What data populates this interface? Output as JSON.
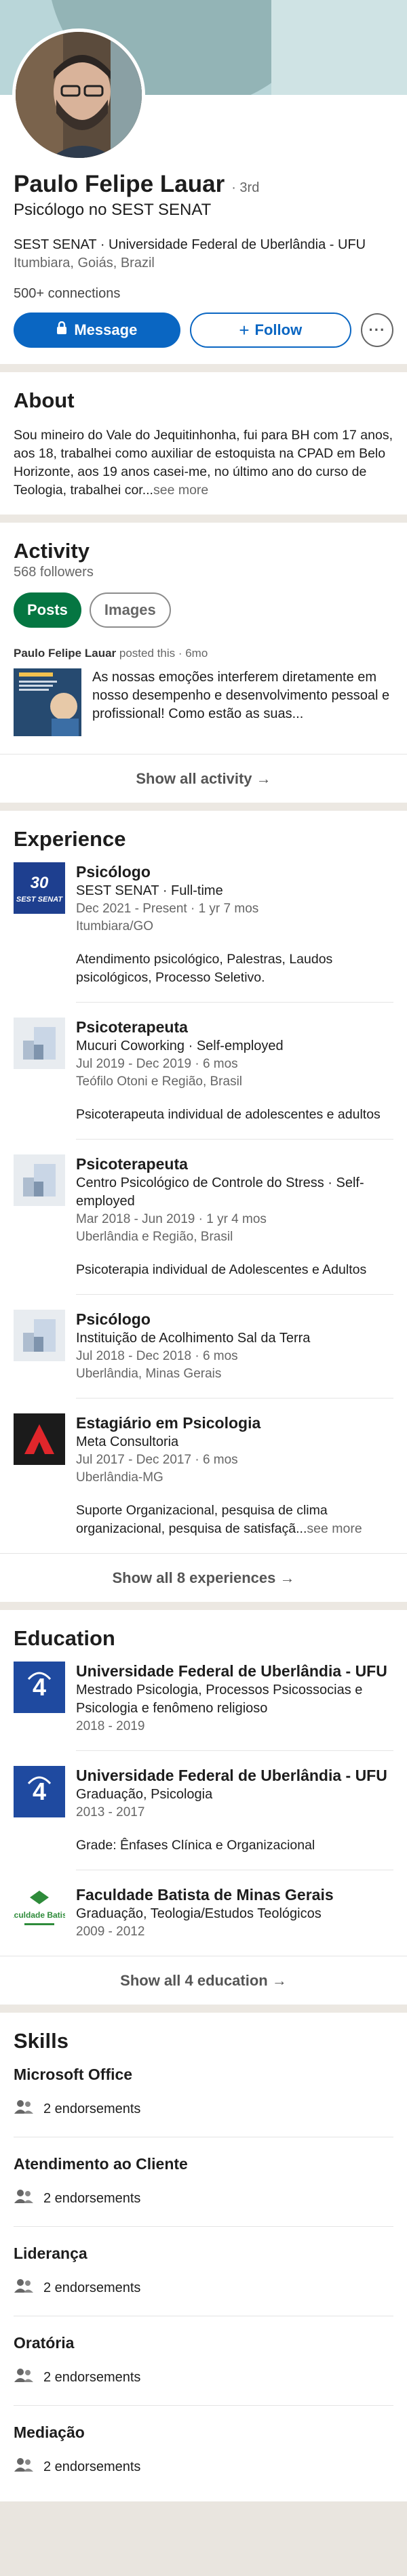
{
  "profile": {
    "name": "Paulo Felipe Lauar",
    "degree": "· 3rd",
    "headline": "Psicólogo no SEST SENAT",
    "education_line": "SEST SENAT · Universidade Federal de Uberlândia - UFU",
    "location": "Itumbiara, Goiás, Brazil",
    "connections": "500+ connections",
    "message_label": "Message",
    "follow_label": "Follow",
    "more_label": "···"
  },
  "about": {
    "title": "About",
    "text": "Sou mineiro do Vale do Jequitinhonha, fui para BH com 17 anos, aos 18, trabalhei como auxiliar de estoquista na CPAD em Belo Horizonte, aos 19 anos casei-me, no último ano do curso de Teologia, trabalhei cor...",
    "see_more": "see more"
  },
  "activity": {
    "title": "Activity",
    "followers": "568 followers",
    "tabs": [
      "Posts",
      "Images"
    ],
    "post_author": "Paulo Felipe Lauar",
    "post_meta": " posted this · 6mo",
    "post_text": "As nossas emoções interferem diretamente em nosso desempenho e desenvolvimento pessoal e profissional! Como estão as suas...",
    "show_all": "Show all activity →"
  },
  "experience": {
    "title": "Experience",
    "items": [
      {
        "title": "Psicólogo",
        "company": "SEST SENAT · Full-time",
        "dates": "Dec 2021 - Present · 1 yr 7 mos",
        "location": "Itumbiara/GO",
        "description": "Atendimento psicológico, Palestras, Laudos psicológicos, Processo Seletivo."
      },
      {
        "title": "Psicoterapeuta",
        "company": "Mucuri Coworking · Self-employed",
        "dates": "Jul 2019 - Dec 2019 · 6 mos",
        "location": "Teófilo Otoni e Região, Brasil",
        "description": "Psicoterapeuta individual de adolescentes e adultos"
      },
      {
        "title": "Psicoterapeuta",
        "company": "Centro Psicológico de Controle do Stress · Self-employed",
        "dates": "Mar 2018 - Jun 2019 · 1 yr 4 mos",
        "location": "Uberlândia e Região, Brasil",
        "description": "Psicoterapia individual de Adolescentes e Adultos"
      },
      {
        "title": "Psicólogo",
        "company": "Instituição de Acolhimento Sal da Terra",
        "dates": "Jul 2018 - Dec 2018 · 6 mos",
        "location": "Uberlândia, Minas Gerais",
        "description": ""
      },
      {
        "title": "Estagiário em Psicologia",
        "company": "Meta Consultoria",
        "dates": "Jul 2017 - Dec 2017 · 6 mos",
        "location": "Uberlândia-MG",
        "description": "Suporte Organizacional, pesquisa de clima organizacional, pesquisa de satisfaçã...",
        "see_more": "see more"
      }
    ],
    "logo_sest_text": "SEST SENAT",
    "show_all": "Show all 8 experiences →"
  },
  "education": {
    "title": "Education",
    "items": [
      {
        "school": "Universidade Federal de Uberlândia - UFU",
        "degree": "Mestrado Psicologia, Processos Psicossocias e Psicologia e fenômeno religioso",
        "dates": "2018 - 2019",
        "grade": ""
      },
      {
        "school": "Universidade Federal de Uberlândia - UFU",
        "degree": "Graduação, Psicologia",
        "dates": "2013 - 2017",
        "grade": "Grade: Ênfases Clínica e Organizacional"
      },
      {
        "school": "Faculdade Batista de Minas Gerais",
        "degree": "Graduação, Teologia/Estudos Teológicos",
        "dates": "2009 - 2012",
        "grade": ""
      }
    ],
    "fb_logo_text": "Faculdade Batista",
    "show_all": "Show all 4 education →"
  },
  "skills": {
    "title": "Skills",
    "items": [
      {
        "name": "Microsoft Office",
        "endorsements": "2 endorsements"
      },
      {
        "name": "Atendimento ao Cliente",
        "endorsements": "2 endorsements"
      },
      {
        "name": "Liderança",
        "endorsements": "2 endorsements"
      },
      {
        "name": "Oratória",
        "endorsements": "2 endorsements"
      },
      {
        "name": "Mediação",
        "endorsements": "2 endorsements"
      }
    ]
  },
  "colors": {
    "primary": "#0a66c2",
    "green": "#057642",
    "muted": "#666666"
  }
}
